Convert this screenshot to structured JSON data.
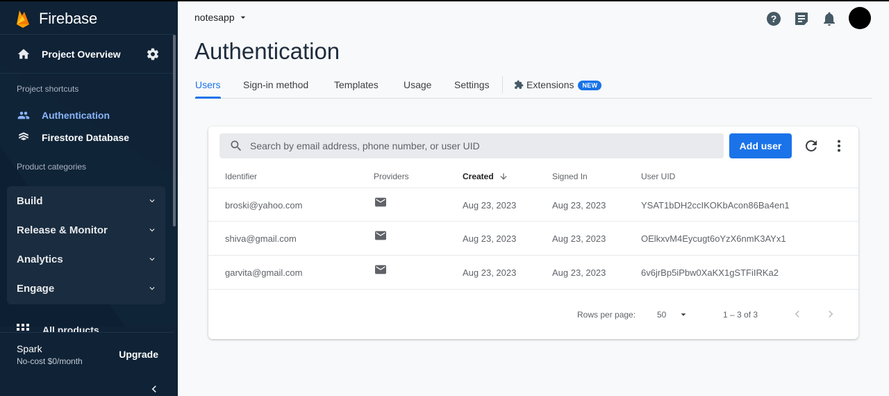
{
  "sidebar": {
    "brand": "Firebase",
    "project_overview": "Project Overview",
    "shortcuts_title": "Project shortcuts",
    "shortcuts": [
      {
        "label": "Authentication",
        "icon": "people-icon",
        "active": true
      },
      {
        "label": "Firestore Database",
        "icon": "firestore-icon",
        "active": false
      }
    ],
    "categories_title": "Product categories",
    "categories": [
      {
        "label": "Build"
      },
      {
        "label": "Release & Monitor"
      },
      {
        "label": "Analytics"
      },
      {
        "label": "Engage"
      }
    ],
    "all_products": "All products",
    "plan": {
      "name": "Spark",
      "cost": "No-cost $0/month",
      "upgrade": "Upgrade"
    }
  },
  "header": {
    "project": "notesapp",
    "title": "Authentication",
    "icons": [
      "help-icon",
      "feedback-icon",
      "notifications-icon",
      "avatar"
    ]
  },
  "tabs": [
    {
      "label": "Users",
      "active": true
    },
    {
      "label": "Sign-in method"
    },
    {
      "label": "Templates"
    },
    {
      "label": "Usage"
    },
    {
      "label": "Settings"
    },
    {
      "label": "Extensions",
      "badge": "NEW"
    }
  ],
  "users_table": {
    "search_placeholder": "Search by email address, phone number, or user UID",
    "add_user": "Add user",
    "columns": [
      "Identifier",
      "Providers",
      "Created",
      "Signed In",
      "User UID"
    ],
    "sorted_column": "Created",
    "rows": [
      {
        "identifier": "broski@yahoo.com",
        "provider": "email-icon",
        "created": "Aug 23, 2023",
        "signed_in": "Aug 23, 2023",
        "uid": "YSAT1bDH2ccIKOKbAcon86Ba4en1"
      },
      {
        "identifier": "shiva@gmail.com",
        "provider": "email-icon",
        "created": "Aug 23, 2023",
        "signed_in": "Aug 23, 2023",
        "uid": "OElkxvM4Eycugt6oYzX6nmK3AYx1"
      },
      {
        "identifier": "garvita@gmail.com",
        "provider": "email-icon",
        "created": "Aug 23, 2023",
        "signed_in": "Aug 23, 2023",
        "uid": "6v6jrBp5iPbw0XaKX1gSTFiIRKa2"
      }
    ],
    "pagination": {
      "rows_per_page_label": "Rows per page:",
      "rows_per_page": "50",
      "range": "1 – 3 of 3"
    }
  },
  "colors": {
    "sidebar_bg": "#0f2236",
    "accent": "#1a73e8",
    "active_nav": "#8ab4f8"
  }
}
